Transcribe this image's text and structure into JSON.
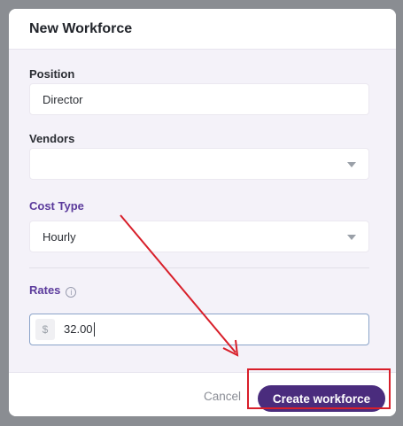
{
  "modal": {
    "title": "New Workforce"
  },
  "form": {
    "position": {
      "label": "Position",
      "value": "Director"
    },
    "vendors": {
      "label": "Vendors",
      "value": ""
    },
    "cost_type": {
      "label": "Cost Type",
      "value": "Hourly"
    },
    "rates": {
      "label": "Rates",
      "currency_symbol": "$",
      "value": "32.00"
    }
  },
  "footer": {
    "cancel_label": "Cancel",
    "create_label": "Create workforce"
  },
  "annotations": {
    "arrow_color": "#d81f2a",
    "highlight_color": "#d81f2a"
  }
}
